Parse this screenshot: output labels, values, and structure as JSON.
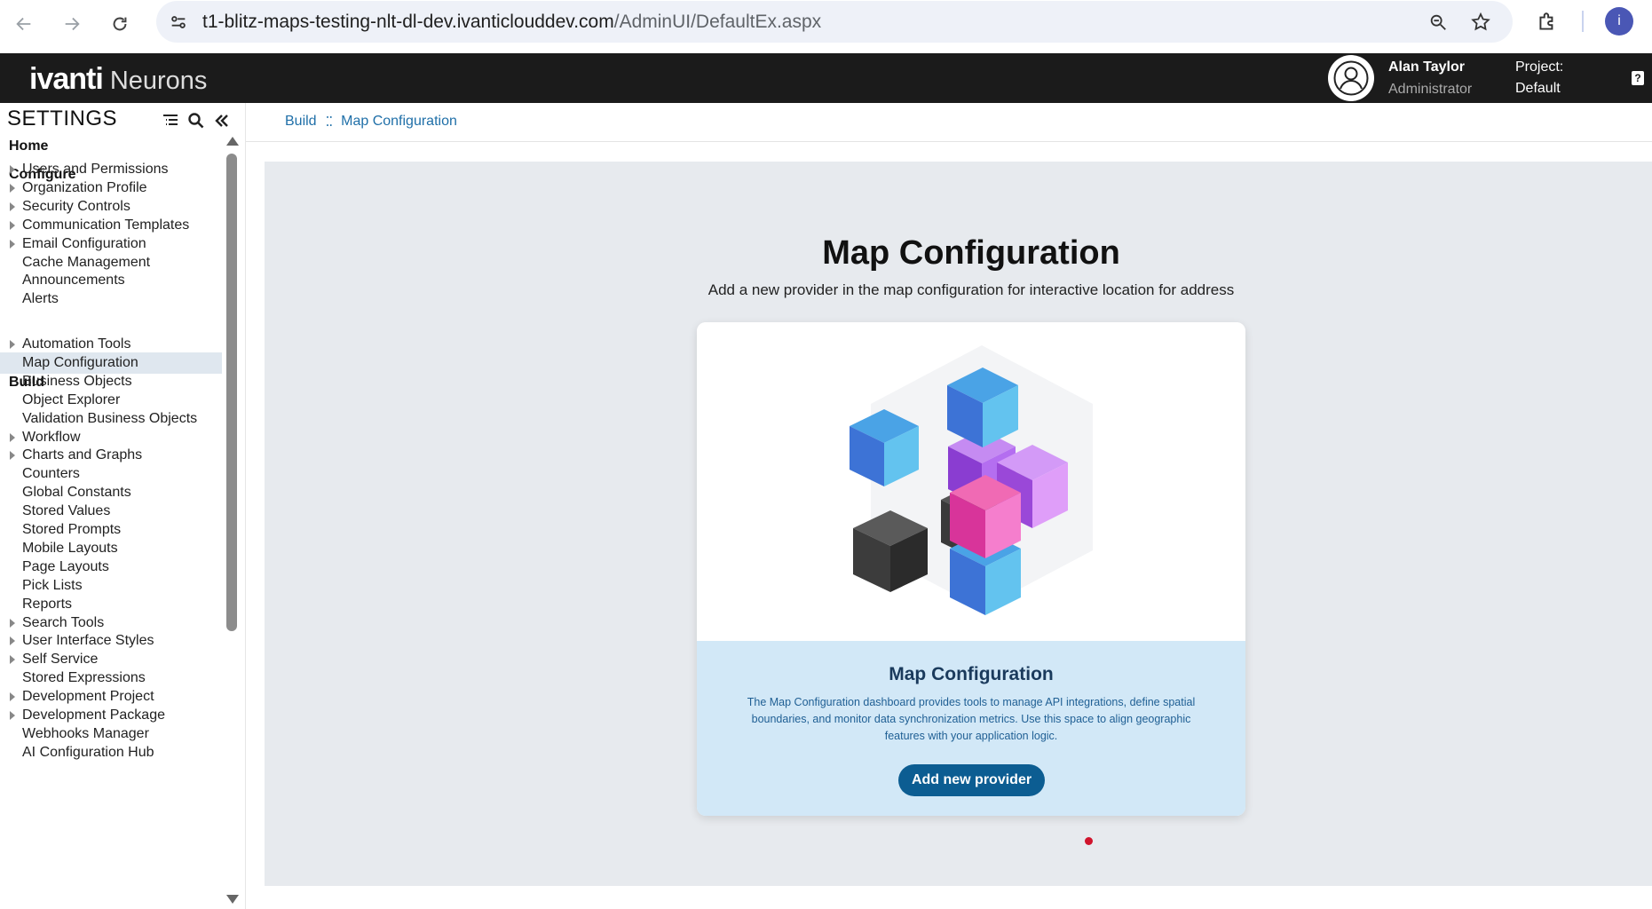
{
  "browser": {
    "url_host": "t1-blitz-maps-testing-nlt-dl-dev.ivanticlouddev.com",
    "url_path": "/AdminUI/DefaultEx.aspx",
    "profile_initial": "i"
  },
  "header": {
    "brand": "ivanti",
    "product": "Neurons",
    "user_name": "Alan Taylor",
    "user_role": "Administrator",
    "project_label": "Project:",
    "project_value": "Default",
    "help_glyph": "?"
  },
  "sidebar": {
    "title": "SETTINGS",
    "home": "Home",
    "configure_label": "Configure",
    "configure_items": [
      {
        "label": "Users and Permissions",
        "expandable": true
      },
      {
        "label": "Organization Profile",
        "expandable": true
      },
      {
        "label": "Security Controls",
        "expandable": true
      },
      {
        "label": "Communication Templates",
        "expandable": true
      },
      {
        "label": "Email Configuration",
        "expandable": true
      },
      {
        "label": "Cache Management",
        "expandable": false
      },
      {
        "label": "Announcements",
        "expandable": false
      },
      {
        "label": "Alerts",
        "expandable": false
      }
    ],
    "build_label": "Build",
    "build_items": [
      {
        "label": "Automation Tools",
        "expandable": true
      },
      {
        "label": "Map Configuration",
        "expandable": false,
        "selected": true
      },
      {
        "label": "Business Objects",
        "expandable": false
      },
      {
        "label": "Object Explorer",
        "expandable": false
      },
      {
        "label": "Validation Business Objects",
        "expandable": false
      },
      {
        "label": "Workflow",
        "expandable": true
      },
      {
        "label": "Charts and Graphs",
        "expandable": true
      },
      {
        "label": "Counters",
        "expandable": false
      },
      {
        "label": "Global Constants",
        "expandable": false
      },
      {
        "label": "Stored Values",
        "expandable": false
      },
      {
        "label": "Stored Prompts",
        "expandable": false
      },
      {
        "label": "Mobile Layouts",
        "expandable": false
      },
      {
        "label": "Page Layouts",
        "expandable": false
      },
      {
        "label": "Pick Lists",
        "expandable": false
      },
      {
        "label": "Reports",
        "expandable": false
      },
      {
        "label": "Search Tools",
        "expandable": true
      },
      {
        "label": "User Interface Styles",
        "expandable": true
      },
      {
        "label": "Self Service",
        "expandable": true
      },
      {
        "label": "Stored Expressions",
        "expandable": false
      },
      {
        "label": "Development Project",
        "expandable": true
      },
      {
        "label": "Development Package",
        "expandable": true
      },
      {
        "label": "Webhooks Manager",
        "expandable": false
      },
      {
        "label": "AI Configuration Hub",
        "expandable": false
      }
    ]
  },
  "breadcrumb": {
    "parent": "Build",
    "separator": "⁚⁚",
    "current": "Map Configuration"
  },
  "main": {
    "title": "Map Configuration",
    "subtitle": "Add a new provider in the map configuration for interactive location for address",
    "card": {
      "title": "Map Configuration",
      "description": "The Map Configuration dashboard provides tools to manage API integrations, define spatial boundaries, and monitor data synchronization metrics. Use this space to align geographic features with your application logic.",
      "button_label": "Add new provider"
    }
  },
  "colors": {
    "header_bg": "#1b1b1b",
    "link": "#1f6fa8",
    "button": "#0c5d92",
    "card_body": "#d2e8f7",
    "dot": "#d0142c"
  }
}
